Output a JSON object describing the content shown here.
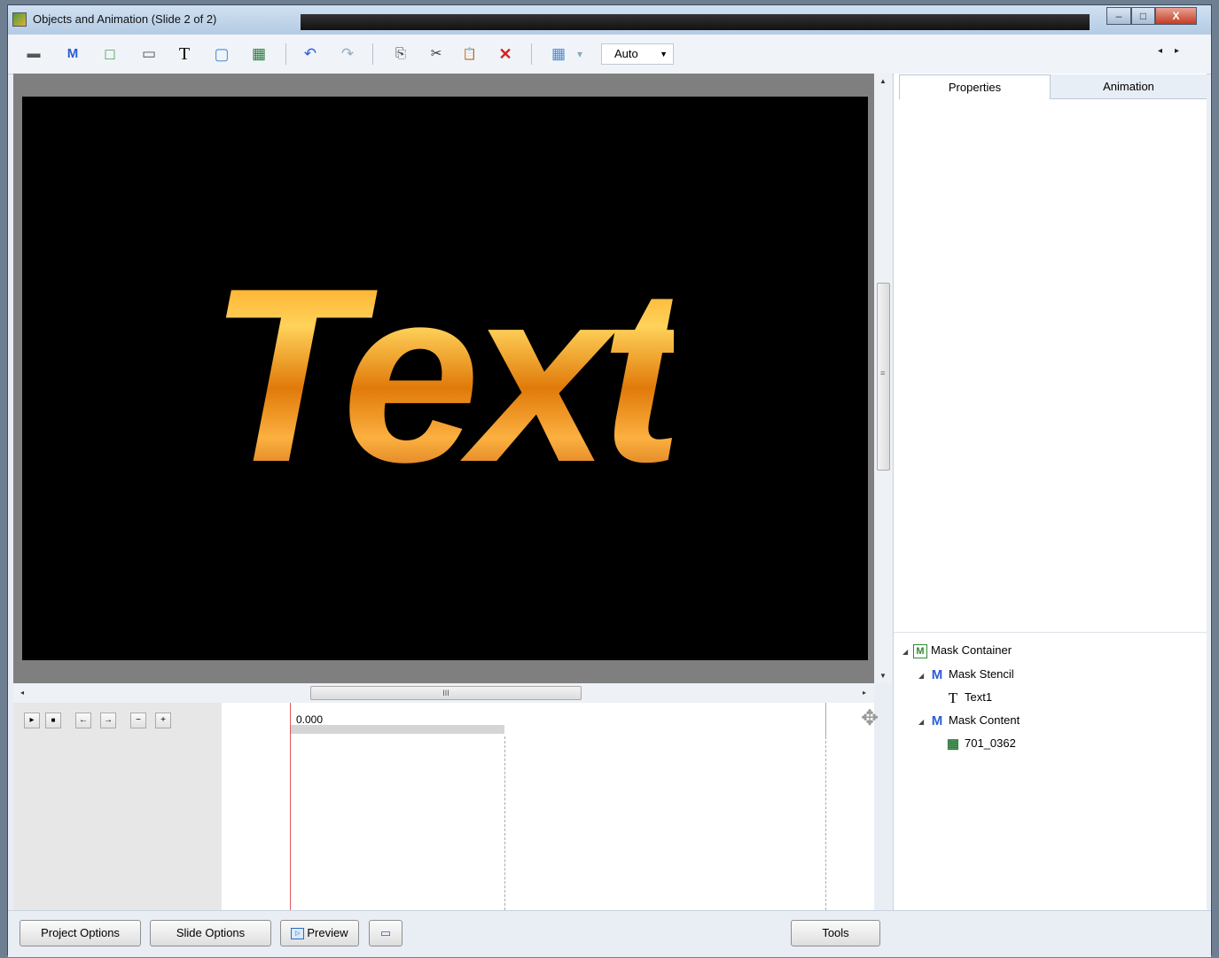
{
  "window": {
    "title": "Objects and Animation (Slide 2 of 2)",
    "min_glyph": "–",
    "max_glyph": "□",
    "close_glyph": "X"
  },
  "toolbar": {
    "icons": [
      "camera-icon",
      "mask-icon",
      "frame-icon",
      "button-icon",
      "text-icon",
      "rectangle-icon",
      "image-icon",
      "undo-icon",
      "redo-icon",
      "copy-icon",
      "cut-icon",
      "paste-icon",
      "delete-icon",
      "grid-icon"
    ],
    "glyphs": {
      "camera": "▬",
      "mask": "M",
      "frame": "□",
      "button": "▭",
      "text": "T",
      "rectangle": "▢",
      "image": "▦",
      "undo": "↶",
      "redo": "↷",
      "copy": "⎘",
      "cut": "✂",
      "paste": "📋",
      "delete": "✕",
      "grid": "▦",
      "grid_dropdown": "▾"
    },
    "zoom": "Auto",
    "zoom_arrow": "▼",
    "nav_arrows": "◂▸"
  },
  "canvas": {
    "slide_text": "Text",
    "hscroll_grip": "III",
    "vscroll_grip": "≡",
    "arrow_up": "▲",
    "arrow_down": "▼",
    "arrow_left": "◂",
    "arrow_right": "▸"
  },
  "timeline": {
    "controls": {
      "play": "▸",
      "stop": "■",
      "prev": "←",
      "next": "→",
      "zoom_out": "−",
      "zoom_in": "+"
    },
    "current_time": "0.000",
    "move_glyph": "✥"
  },
  "panel": {
    "tabs": [
      "Properties",
      "Animation"
    ],
    "active_tab": "Properties",
    "tree": [
      {
        "label": "Mask Container",
        "icon": "mask-container-icon",
        "glyph": "M",
        "expanded": true
      },
      {
        "label": "Mask Stencil",
        "icon": "mask-stencil-icon",
        "glyph": "M",
        "expanded": true
      },
      {
        "label": "Text1",
        "icon": "text-icon",
        "glyph": "T",
        "expanded": false
      },
      {
        "label": "Mask Content",
        "icon": "mask-content-icon",
        "glyph": "M",
        "expanded": true
      },
      {
        "label": "701_0362",
        "icon": "image-icon",
        "glyph": "▦",
        "expanded": false
      }
    ],
    "expand_glyph": "◢"
  },
  "bottom": {
    "project_options": "Project Options",
    "slide_options": "Slide Options",
    "preview": "Preview",
    "preview_glyph": "▷",
    "window_glyph": "▭",
    "tools": "Tools"
  },
  "colors": {
    "accent_blue": "#2a5dd8",
    "delete_red": "#d42020",
    "playhead": "#e35a5a",
    "text_fill": "#f09020"
  }
}
